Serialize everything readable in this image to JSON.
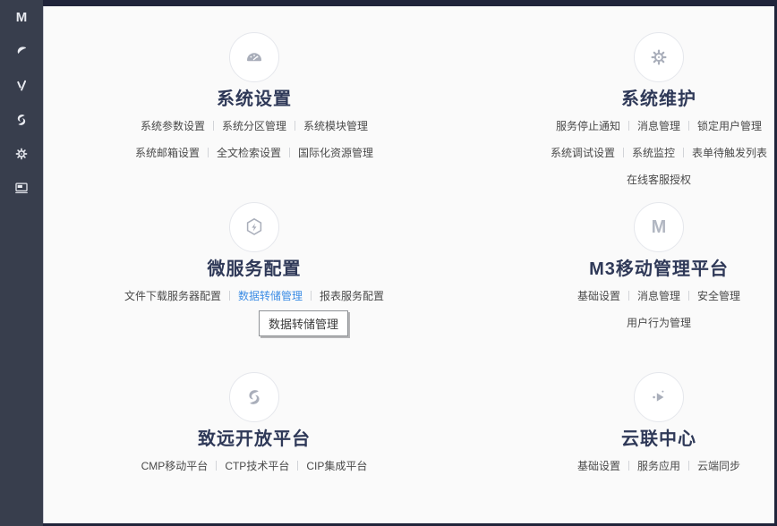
{
  "sidebar": {
    "items": [
      {
        "icon": "m-logo-icon"
      },
      {
        "icon": "swoosh-icon"
      },
      {
        "icon": "v-mark-icon"
      },
      {
        "icon": "seeyon-s-icon"
      },
      {
        "icon": "gear-icon"
      },
      {
        "icon": "monitor-icon"
      }
    ]
  },
  "sections": [
    {
      "id": "system-settings",
      "title": "系统设置",
      "icon": "gauge-icon",
      "link_rows": [
        [
          "系统参数设置",
          "系统分区管理",
          "系统模块管理"
        ],
        [
          "系统邮箱设置",
          "全文检索设置",
          "国际化资源管理"
        ]
      ]
    },
    {
      "id": "system-maintenance",
      "title": "系统维护",
      "icon": "gear-icon",
      "link_rows": [
        [
          "服务停止通知",
          "消息管理",
          "锁定用户管理"
        ],
        [
          "系统调试设置",
          "系统监控",
          "表单待触发列表"
        ],
        [
          "在线客服授权"
        ]
      ]
    },
    {
      "id": "microservice-config",
      "title": "微服务配置",
      "icon": "hexagon-bolt-icon",
      "link_rows": [
        [
          "文件下载服务器配置",
          "数据转储管理",
          "报表服务配置"
        ]
      ],
      "active_link": "数据转储管理",
      "tooltip": "数据转储管理"
    },
    {
      "id": "m3-mobile-platform",
      "title": "M3移动管理平台",
      "icon": "m-logo-icon",
      "link_rows": [
        [
          "基础设置",
          "消息管理",
          "安全管理"
        ],
        [
          "用户行为管理"
        ]
      ]
    },
    {
      "id": "seeyon-open-platform",
      "title": "致远开放平台",
      "icon": "seeyon-s-icon",
      "link_rows": [
        [
          "CMP移动平台",
          "CTP技术平台",
          "CIP集成平台"
        ]
      ]
    },
    {
      "id": "cloud-link-center",
      "title": "云联中心",
      "icon": "play-dots-icon",
      "link_rows": [
        [
          "基础设置",
          "服务应用",
          "云端同步"
        ]
      ]
    }
  ],
  "colors": {
    "frame": "#20243a",
    "sidebar_bg": "#383e4d",
    "canvas_bg": "#fafafa",
    "title_text": "#2f3958",
    "link_text": "#4a4a4a",
    "link_active": "#3d8de5",
    "icon_gray": "#a9aeba"
  }
}
